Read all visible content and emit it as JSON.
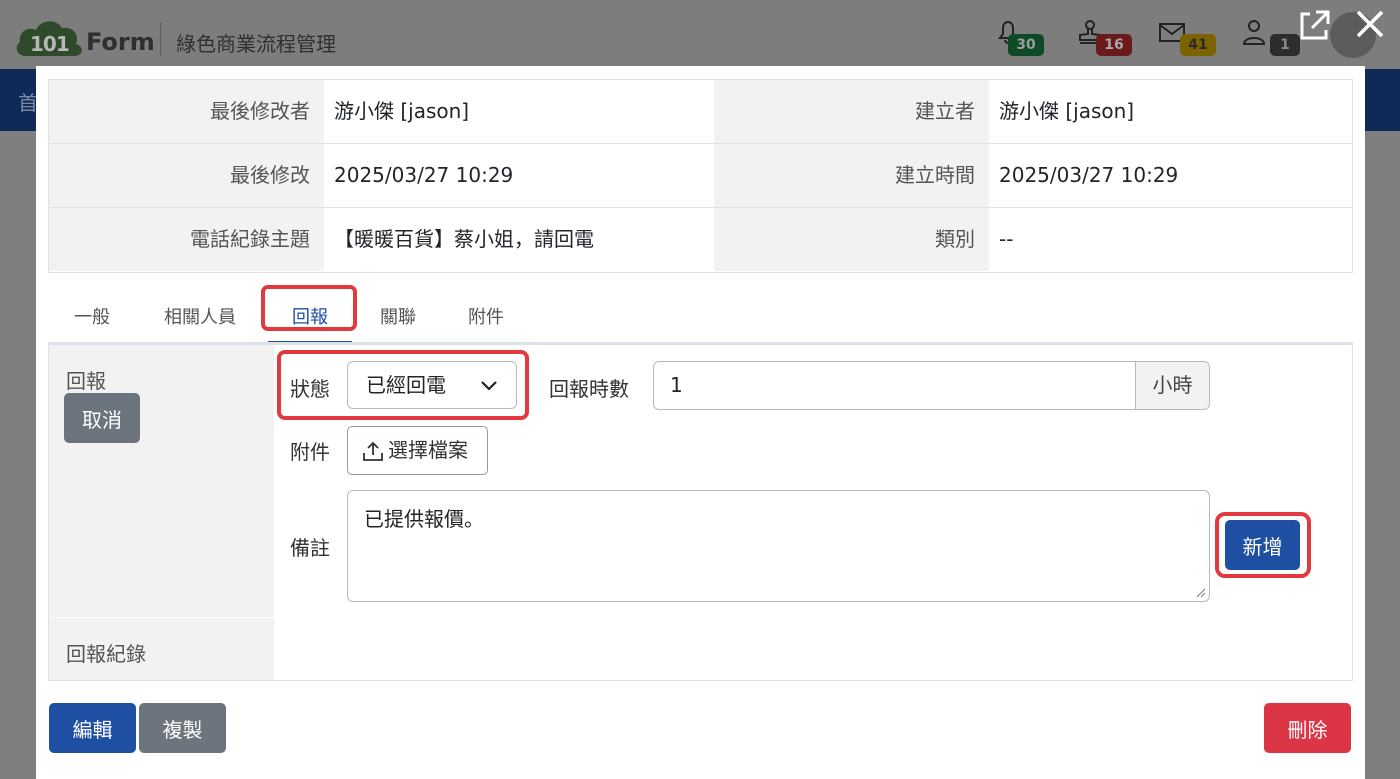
{
  "app": {
    "logo_number": "101",
    "logo_text": "Form",
    "title": "綠色商業流程管理",
    "nav_first_char": "首"
  },
  "notifications": [
    {
      "icon": "bell-icon",
      "count": "30",
      "color": "#0e4a26"
    },
    {
      "icon": "stamp-icon",
      "count": "16",
      "color": "#6b1a1c"
    },
    {
      "icon": "mail-icon",
      "count": "41",
      "color": "#7d6300"
    },
    {
      "icon": "user-icon",
      "count": "1",
      "color": "#2b2d2f"
    }
  ],
  "modal": {
    "info": {
      "last_modifier_label": "最後修改者",
      "last_modifier_value": "游小傑 [jason]",
      "creator_label": "建立者",
      "creator_value": "游小傑 [jason]",
      "last_modified_label": "最後修改",
      "last_modified_value": "2025/03/27 10:29",
      "created_time_label": "建立時間",
      "created_time_value": "2025/03/27 10:29",
      "subject_label": "電話紀錄主題",
      "subject_value": "【暖暖百貨】蔡小姐，請回電",
      "category_label": "類別",
      "category_value": "--"
    },
    "tabs": [
      {
        "label": "一般",
        "active": false
      },
      {
        "label": "相關人員",
        "active": false
      },
      {
        "label": "回報",
        "active": true
      },
      {
        "label": "關聯",
        "active": false
      },
      {
        "label": "附件",
        "active": false
      }
    ],
    "report": {
      "side_label": "回報",
      "cancel_label": "取消",
      "records_label": "回報紀錄",
      "status_label": "狀態",
      "status_value": "已經回電",
      "hours_label": "回報時數",
      "hours_value": "1",
      "hours_unit": "小時",
      "attachment_label": "附件",
      "choose_file_label": "選擇檔案",
      "note_label": "備註",
      "note_value": "已提供報價。",
      "add_label": "新增"
    },
    "footer": {
      "edit_label": "編輯",
      "copy_label": "複製",
      "delete_label": "刪除"
    }
  },
  "colors": {
    "primary": "#1f4fa3",
    "danger": "#dc3545",
    "secondary": "#6c757d",
    "highlight": "#e1393d"
  }
}
